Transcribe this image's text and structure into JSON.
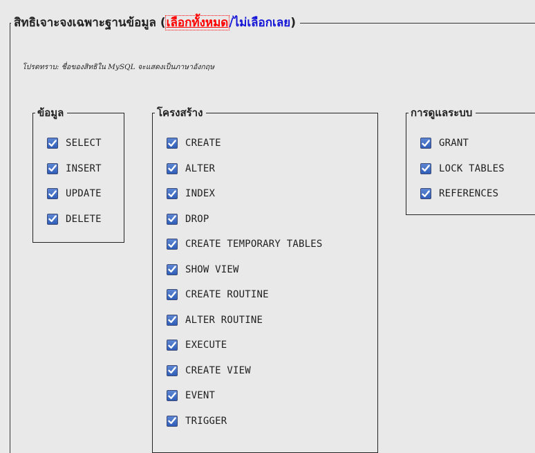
{
  "fieldset": {
    "title_prefix": "สิทธิเจาะจงเฉพาะฐานข้อมูล (",
    "select_all": "เลือกทั้งหมด",
    "separator": "/",
    "select_none": "ไม่เลือกเลย",
    "title_suffix": ")"
  },
  "notice": "โปรดทราบ: ชื่อของสิทธิใน MySQL จะแสดงเป็นภาษาอังกฤษ",
  "groups": [
    {
      "legend": "ข้อมูล",
      "items": [
        {
          "label": "SELECT",
          "checked": true
        },
        {
          "label": "INSERT",
          "checked": true
        },
        {
          "label": "UPDATE",
          "checked": true
        },
        {
          "label": "DELETE",
          "checked": true
        }
      ]
    },
    {
      "legend": "โครงสร้าง",
      "items": [
        {
          "label": "CREATE",
          "checked": true
        },
        {
          "label": "ALTER",
          "checked": true
        },
        {
          "label": "INDEX",
          "checked": true
        },
        {
          "label": "DROP",
          "checked": true
        },
        {
          "label": "CREATE TEMPORARY TABLES",
          "checked": true
        },
        {
          "label": "SHOW VIEW",
          "checked": true
        },
        {
          "label": "CREATE ROUTINE",
          "checked": true
        },
        {
          "label": "ALTER ROUTINE",
          "checked": true
        },
        {
          "label": "EXECUTE",
          "checked": true
        },
        {
          "label": "CREATE VIEW",
          "checked": true
        },
        {
          "label": "EVENT",
          "checked": true
        },
        {
          "label": "TRIGGER",
          "checked": true
        }
      ]
    },
    {
      "legend": "การดูแลระบบ",
      "items": [
        {
          "label": "GRANT",
          "checked": true
        },
        {
          "label": "LOCK TABLES",
          "checked": true
        },
        {
          "label": "REFERENCES",
          "checked": true
        }
      ]
    }
  ],
  "colors": {
    "select_all": "#ff0000",
    "select_none": "#1515d8",
    "checkbox": "#2f5db8"
  },
  "icons": {
    "checkbox": "checkmark-icon"
  }
}
